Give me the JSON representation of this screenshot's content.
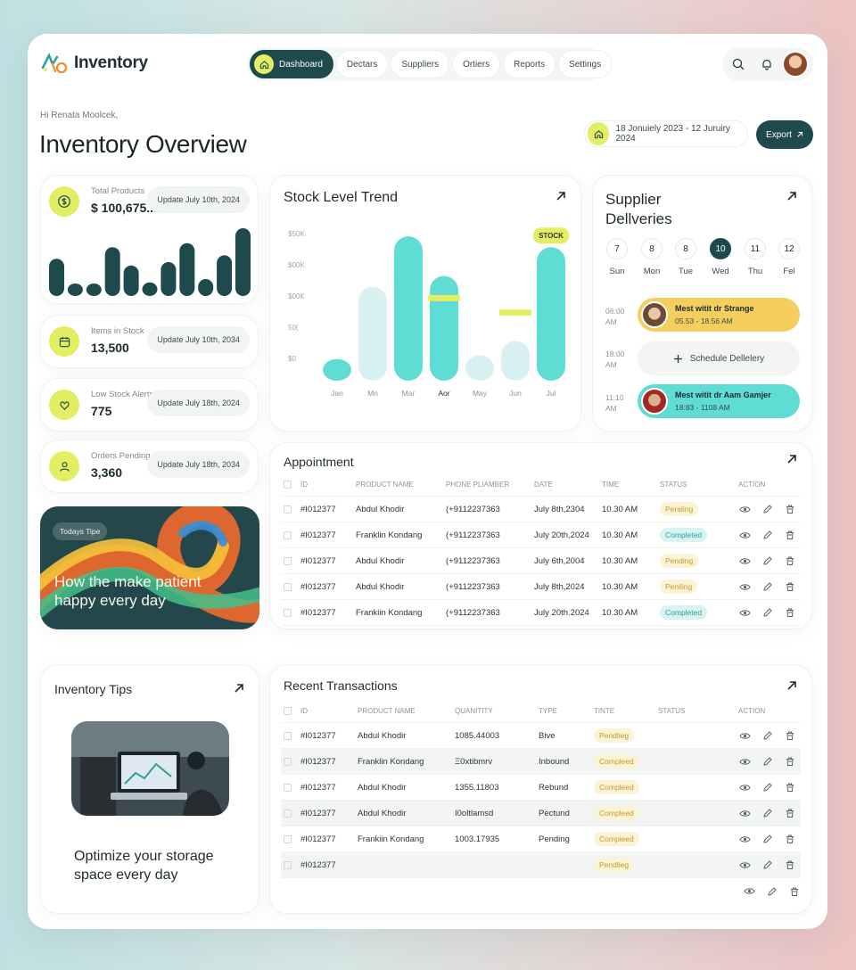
{
  "app": {
    "name": "Inventory"
  },
  "nav": {
    "items": [
      {
        "label": "Dashboard",
        "active": true
      },
      {
        "label": "Dectars"
      },
      {
        "label": "Suppliers"
      },
      {
        "label": "Ortiers"
      },
      {
        "label": "Reports"
      },
      {
        "label": "Settings"
      }
    ]
  },
  "header": {
    "greeting": "Hi Renata Moolcek,",
    "title": "Inventory Overview",
    "date_range": "18 Jonuiely 2023 - 12 Juruiry 2024",
    "export_label": "Export"
  },
  "stats": [
    {
      "label": "Total Products",
      "value": "$ 100,675...",
      "update": "Update July 10th, 2024",
      "icon": "dollar-icon"
    },
    {
      "label": "Items in Stock",
      "value": "13,500",
      "update": "Update July 10th, 2034",
      "icon": "calendar-icon"
    },
    {
      "label": "Low Stock Alerts",
      "value": "775",
      "update": "Update July 18th, 2024",
      "icon": "alert-icon"
    },
    {
      "label": "Orders Pending",
      "value": "3,360",
      "update": "Update July 18th, 2034",
      "icon": "orders-icon"
    }
  ],
  "mini_bars": [
    0.55,
    0.15,
    0.15,
    0.72,
    0.45,
    0.2,
    0.5,
    0.78,
    0.25,
    0.6,
    1.0
  ],
  "promo": {
    "badge": "Todays Tipe",
    "text": "How the make patient happy every day"
  },
  "chart_data": {
    "type": "bar",
    "title": "Stock Level Trend",
    "categories": [
      "Jan",
      "Mn",
      "Mar",
      "Aor",
      "May",
      "Jun",
      "Jul"
    ],
    "values": [
      60,
      260,
      400,
      290,
      70,
      110,
      370
    ],
    "highlights": [
      {
        "category": "Aor",
        "value": 230
      },
      {
        "category": "Jun",
        "value": 190
      }
    ],
    "y_ticks": [
      "$50K",
      "$00K",
      "$00K",
      "50(",
      "$0"
    ],
    "annotation": {
      "label": "STOCK",
      "category": "Jul"
    },
    "colors": {
      "primary": "#5fdcd4",
      "light": "#d8f0f2",
      "accent": "#e4ee62"
    },
    "ylim": [
      0,
      420
    ]
  },
  "supplier": {
    "title": "Supplier Dellveries",
    "days": [
      {
        "num": "7",
        "name": "Sun"
      },
      {
        "num": "8",
        "name": "Mon"
      },
      {
        "num": "8",
        "name": "Tue"
      },
      {
        "num": "10",
        "name": "Wed",
        "active": true
      },
      {
        "num": "11",
        "name": "Thu"
      },
      {
        "num": "12",
        "name": "Fel"
      }
    ],
    "slots": [
      {
        "time": "06:00 AM",
        "title": "Mest witit dr Strange",
        "range": "05.53 - 18.56 AM",
        "color": "#f4cf5e"
      },
      {
        "time": "18:00 AM",
        "action": "Schedule Dellelery"
      },
      {
        "time": "11:10 AM",
        "title": "Mest witit dr Aam Gamjer",
        "range": "18:83 - 1108 AM",
        "color": "#5fdcd4"
      }
    ]
  },
  "appointment": {
    "title": "Appointment",
    "columns": [
      "ID",
      "Product Name",
      "Phone Pliamber",
      "Date",
      "Time",
      "Status",
      "Action"
    ],
    "rows": [
      {
        "id": "#I012377",
        "name": "Abdul Khodir",
        "phone": "(+9112237363",
        "date": "July 8th,2304",
        "time": "10.30 AM",
        "status": "Peraling",
        "kind": "pending"
      },
      {
        "id": "#I012377",
        "name": "Franklin Kondang",
        "phone": "(+9112237363",
        "date": "July 20th,2024",
        "time": "10.30 AM",
        "status": "Completed",
        "kind": "completed"
      },
      {
        "id": "#I012377",
        "name": "Abdul Khodir",
        "phone": "(+9112237363",
        "date": "July 6th,2004",
        "time": "10.30 AM",
        "status": "Pending",
        "kind": "pending"
      },
      {
        "id": "#I012377",
        "name": "Abdul Khodir",
        "phone": "(+9112237363",
        "date": "July 8th,2024",
        "time": "10.30 AM",
        "status": "Penlling",
        "kind": "pending"
      },
      {
        "id": "#I012377",
        "name": "Frankiin Kondang",
        "phone": "(+9112237363",
        "date": "July 20th.2024",
        "time": "10.30 AM",
        "status": "Completed",
        "kind": "completed"
      }
    ]
  },
  "tips": {
    "title": "Inventory Tips",
    "text": "Optimize your storage space every day"
  },
  "transactions": {
    "title": "Recent Transactions",
    "columns": [
      "ID",
      "Product Name",
      "Quanitity",
      "Type",
      "Tinte",
      "Status",
      "Action"
    ],
    "rows": [
      {
        "id": "#I012377",
        "name": "Abdul Khodir",
        "qty": "1085.44003",
        "type": "Bive",
        "status": "Pendlieg"
      },
      {
        "id": "#I012377",
        "name": "Franklin Kondang",
        "qty": "Ξ0xtibmrv",
        "type": "Inbound",
        "status": "Compleed"
      },
      {
        "id": "#I012377",
        "name": "Abdul Khodir",
        "qty": "1355.11803",
        "type": "Rebund",
        "status": "Compleed"
      },
      {
        "id": "#I012377",
        "name": "Abdul Khodir",
        "qty": "Ι0oltlamsd",
        "type": "Pectund",
        "status": "Compleed"
      },
      {
        "id": "#I012377",
        "name": "Frankiin Kondang",
        "qty": "1003.17935",
        "type": "Pending",
        "status": "Compieed"
      },
      {
        "id": "#I012377",
        "name": "",
        "qty": "",
        "type": "",
        "status": "Pendlieg"
      }
    ]
  }
}
